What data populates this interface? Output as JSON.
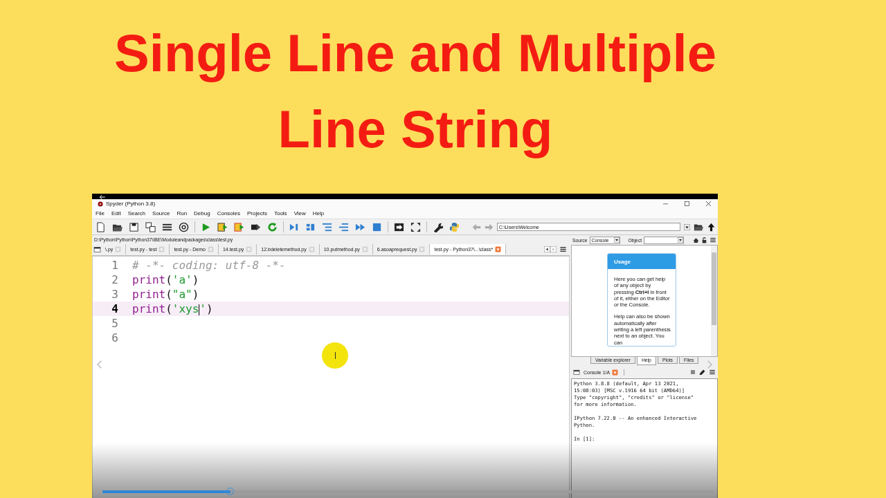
{
  "title_lines": [
    "Single Line and Multiple",
    "Line String"
  ],
  "window": {
    "title": "Spyder (Python 3.8)"
  },
  "menu": [
    "File",
    "Edit",
    "Search",
    "Source",
    "Run",
    "Debug",
    "Consoles",
    "Projects",
    "Tools",
    "View",
    "Help"
  ],
  "working_directory": "C:\\Users\\Welcome",
  "file_path": "D:\\Python\\Python\\Python37\\IBE\\Moduleandpackages\\class\\test.py",
  "editor_tabs": [
    {
      "label": "\\.py",
      "selected": false
    },
    {
      "label": "test.py - test",
      "selected": false
    },
    {
      "label": "test.py - Demo",
      "selected": false
    },
    {
      "label": "14.test.py",
      "selected": false
    },
    {
      "label": "12.bdeletemethod.py",
      "selected": false
    },
    {
      "label": "10.putmethod.py",
      "selected": false
    },
    {
      "label": "6.asoaprequest.py",
      "selected": false
    },
    {
      "label": "test.py - Python37\\...\\class*",
      "selected": true
    }
  ],
  "code_lines": [
    {
      "number": "1",
      "current": false,
      "tokens": [
        {
          "kind": "comment",
          "text": "# -*- coding: utf-8 -*-"
        }
      ]
    },
    {
      "number": "2",
      "current": false,
      "tokens": [
        {
          "kind": "builtin",
          "text": "print"
        },
        {
          "kind": "plain",
          "text": "("
        },
        {
          "kind": "string",
          "text": "'a'"
        },
        {
          "kind": "plain",
          "text": ")"
        }
      ]
    },
    {
      "number": "3",
      "current": false,
      "tokens": [
        {
          "kind": "builtin",
          "text": "print"
        },
        {
          "kind": "plain",
          "text": "("
        },
        {
          "kind": "string",
          "text": "\"a\""
        },
        {
          "kind": "plain",
          "text": ")"
        }
      ]
    },
    {
      "number": "4",
      "current": true,
      "tokens": [
        {
          "kind": "builtin",
          "text": "print"
        },
        {
          "kind": "plain",
          "text": "("
        },
        {
          "kind": "string",
          "text": "'xys"
        },
        {
          "kind": "caret"
        },
        {
          "kind": "string",
          "text": "'"
        },
        {
          "kind": "plain",
          "text": ")"
        }
      ]
    },
    {
      "number": "5",
      "current": false
    },
    {
      "number": "6",
      "current": false
    }
  ],
  "help": {
    "source_label": "Source",
    "source_value": "Console",
    "object_label": "Object",
    "card_title": "Usage",
    "paragraphs": [
      "Here you can get help of any object by pressing **Ctrl+I** in front of it, either on the Editor or the Console.",
      "Help can also be shown automatically after writing a left parenthesis next to an object. You can"
    ]
  },
  "pane_tabs": [
    {
      "label": "Variable explorer",
      "selected": false
    },
    {
      "label": "Help",
      "selected": true
    },
    {
      "label": "Plots",
      "selected": false
    },
    {
      "label": "Files",
      "selected": false
    }
  ],
  "console": {
    "tab": "Console 1/A",
    "blocks": [
      [
        "Python 3.8.8 (default, Apr 13 2021,",
        "15:08:03) [MSC v.1916 64 bit (AMD64)]",
        "Type \"copyright\", \"credits\" or \"license\"",
        "for more information."
      ],
      [
        "IPython 7.22.0 -- An enhanced Interactive",
        "Python."
      ],
      [
        "In [1]:"
      ]
    ]
  },
  "video": {
    "level": 0.21
  }
}
